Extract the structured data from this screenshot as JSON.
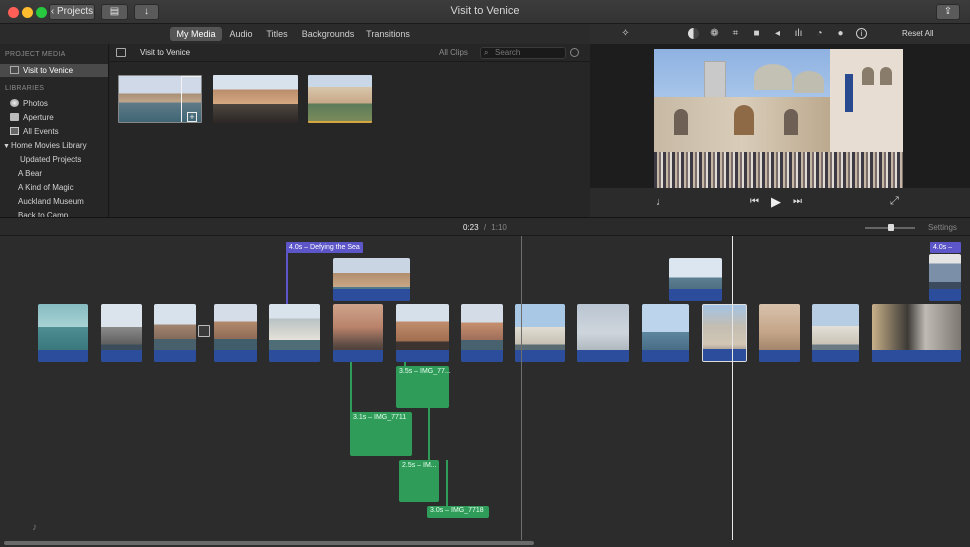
{
  "window": {
    "title": "Visit to Venice",
    "projects_button": "Projects",
    "colors": {
      "close": "#ff5f57",
      "minimize": "#febc2e",
      "zoom": "#28c840"
    }
  },
  "tabs": [
    {
      "label": "My Media",
      "active": true
    },
    {
      "label": "Audio",
      "active": false
    },
    {
      "label": "Titles",
      "active": false
    },
    {
      "label": "Backgrounds",
      "active": false
    },
    {
      "label": "Transitions",
      "active": false
    }
  ],
  "sidebar": {
    "project_media_header": "PROJECT MEDIA",
    "project_item": "Visit to Venice",
    "libraries_header": "LIBRARIES",
    "items": [
      {
        "label": "Photos",
        "icon": "photos-icon"
      },
      {
        "label": "Aperture",
        "icon": "aperture-icon"
      },
      {
        "label": "All Events",
        "icon": "events-icon"
      }
    ],
    "library": "Home Movies Library",
    "events": [
      "Updated Projects",
      "A Bear",
      "A Kind of Magic",
      "Auckland Museum",
      "Back to Camp"
    ]
  },
  "browser": {
    "title": "Visit to Venice",
    "filter": "All Clips",
    "search_placeholder": "Search"
  },
  "viewer": {
    "reset_label": "Reset All"
  },
  "timeline": {
    "current_time": "0:23",
    "separator": "/",
    "total_time": "1:10",
    "settings_label": "Settings",
    "titles": [
      "4.0s – Defying the Sea",
      "4.0s –"
    ],
    "audio_clips": [
      "3.5s – IMG_77...",
      "3.1s – IMG_7711",
      "2.5s – IM...",
      "3.0s – IMG_7718"
    ]
  }
}
